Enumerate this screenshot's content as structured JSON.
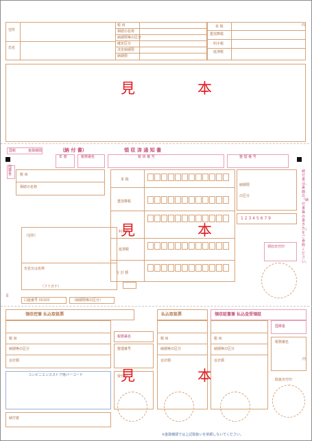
{
  "watermark": {
    "mi": "見",
    "hon": "本"
  },
  "top": {
    "row_labels": [
      "住所",
      "氏名"
    ],
    "cells_mid": [
      "税 目",
      "相続の名称",
      "納期限等の区分",
      "確定区分",
      "法定納期限",
      "納期限"
    ],
    "cells_right": [
      "本 税",
      "重加算税",
      "利子税",
      "延滞税"
    ],
    "yen": "円"
  },
  "band": {
    "left_badge": "国税",
    "left_note": "金融機関",
    "title1": "（納 付 書）",
    "title2": "領 収 済 通 知 書",
    "heads": [
      "年 度",
      "税務署名",
      "税 目 番 号",
      "整 理 番 号"
    ]
  },
  "kokko": "国庫金",
  "main": {
    "left_labels": [
      "税 目",
      "相続の名称"
    ],
    "rows": [
      "本 税",
      "重加算税",
      "利子税",
      "延滞税",
      "合 計 額"
    ],
    "right_labels": [
      "納期限",
      "の区分"
    ],
    "digits": "1 2 3 4 5 6 7 9",
    "address_note": "（住所）",
    "name_label": "氏名又は名称",
    "furigana": "（フリガナ）",
    "account": "口座番号 00200",
    "code_label": "（納期限等の区分）",
    "stamp_note": "領収日付印",
    "side_note": "納付書は、裏面の「納付書等の書き方」をご参照ください。"
  },
  "bottom": {
    "sec1": "領収控兼 払込取扱票",
    "sec2": "払込取扱票",
    "sec3": "領収証書兼 払込金受領証",
    "kokko": "国庫金",
    "labels": [
      "税 目",
      "納期等の区分",
      "合計額"
    ],
    "tax_office": "税務署名",
    "seiri": "整理番号",
    "barcode_label": "コンビニエンスストア用バーコード",
    "address": "住所・氏名",
    "stamp": "受付印",
    "payer": "納付者",
    "seal": "取扱日付印",
    "footer_note": "※金融機関では上記取扱いを依頼しないでください。",
    "yen": "円"
  }
}
